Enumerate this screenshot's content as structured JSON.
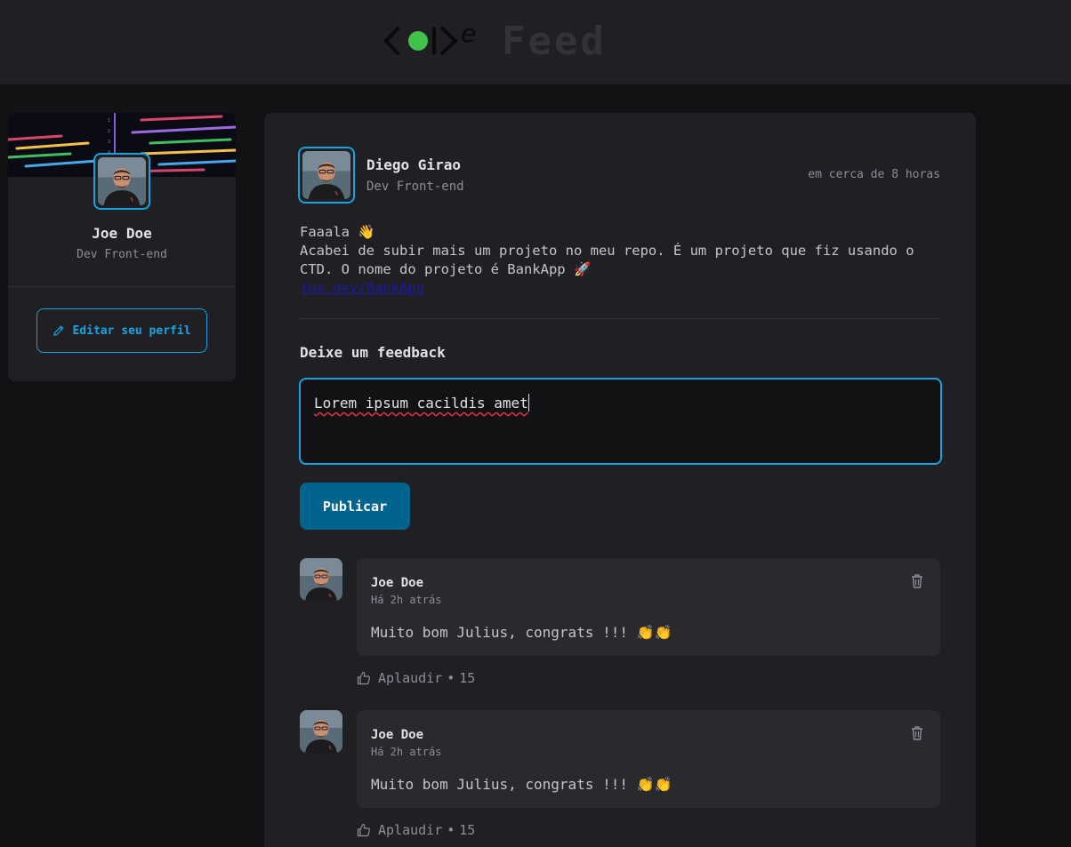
{
  "header": {
    "logo_word": "Feed",
    "logo_mark_icon": "code-logo-icon",
    "accent_green": "#41c34b"
  },
  "sidebar": {
    "name": "Joe Doe",
    "role": "Dev Front-end",
    "edit_button_label": "Editar seu perfil",
    "edit_icon": "pencil-icon"
  },
  "post": {
    "author_name": "Diego Girao",
    "author_role": "Dev Front-end",
    "time": "em cerca de 8 horas",
    "content_lines": [
      "Faaala 👋",
      "Acabei de subir mais um projeto no meu repo. É um projeto que fiz usando o",
      "CTD. O nome do projeto é BankApp 🚀"
    ],
    "link": "joe.dev/BankApp",
    "feedback_label": "Deixe um feedback",
    "feedback_value": "Lorem ipsum cacildis amet",
    "publish_label": "Publicar"
  },
  "comments": [
    {
      "author": "Joe Doe",
      "time": "Há 2h atrás",
      "text": "Muito bom Julius, congrats !!! 👏👏",
      "applaud_label": "Aplaudir",
      "applaud_separator": "•",
      "applaud_count": "15"
    },
    {
      "author": "Joe Doe",
      "time": "Há 2h atrás",
      "text": "Muito bom Julius, congrats !!! 👏👏",
      "applaud_label": "Aplaudir",
      "applaud_separator": "•",
      "applaud_count": "15"
    }
  ],
  "colors": {
    "accent_blue": "#15a3e0",
    "button_blue": "#00648f",
    "background": "#121214",
    "card": "#202024"
  }
}
